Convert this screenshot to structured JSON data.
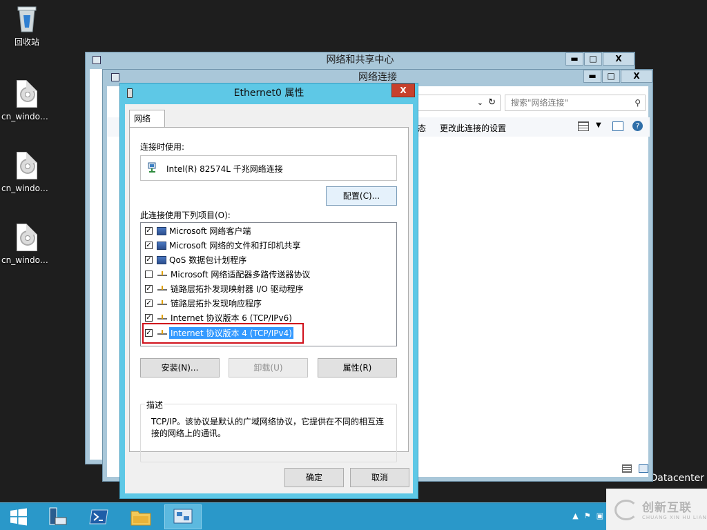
{
  "desktop": {
    "icons": [
      {
        "label": "回收站",
        "icon": "recycle-bin-icon"
      },
      {
        "label": "cn_window...",
        "icon": "disc-image-icon"
      },
      {
        "label": "cn_window...",
        "icon": "disc-image-icon"
      },
      {
        "label": "cn_window...",
        "icon": "disc-image-icon"
      }
    ],
    "side_text": "Datacenter"
  },
  "window_network_center": {
    "title": "网络和共享中心",
    "controls": {
      "minimize": "▬",
      "maximize": "□",
      "close": "X"
    }
  },
  "window_network_connections": {
    "title": "网络连接",
    "controls": {
      "minimize": "▬",
      "maximize": "□",
      "close": "X"
    },
    "search_placeholder": "搜索\"网络连接\"",
    "toolbar": {
      "partial_label": "态",
      "change_settings": "更改此连接的设置"
    }
  },
  "dialog": {
    "title": "Ethernet0 属性",
    "close": "X",
    "tab": "网络",
    "connect_using_label": "连接时使用:",
    "adapter_name": "Intel(R) 82574L 千兆网络连接",
    "configure_button": "配置(C)...",
    "items_label": "此连接使用下列项目(O):",
    "items": [
      {
        "checked": true,
        "icon": "network-client-icon",
        "label": "Microsoft 网络客户端",
        "selected": false
      },
      {
        "checked": true,
        "icon": "network-service-icon",
        "label": "Microsoft 网络的文件和打印机共享",
        "selected": false
      },
      {
        "checked": true,
        "icon": "network-service-icon",
        "label": "QoS 数据包计划程序",
        "selected": false
      },
      {
        "checked": false,
        "icon": "protocol-icon",
        "label": "Microsoft 网络适配器多路传送器协议",
        "selected": false
      },
      {
        "checked": true,
        "icon": "protocol-icon",
        "label": "链路层拓扑发现映射器 I/O 驱动程序",
        "selected": false
      },
      {
        "checked": true,
        "icon": "protocol-icon",
        "label": "链路层拓扑发现响应程序",
        "selected": false
      },
      {
        "checked": true,
        "icon": "protocol-icon",
        "label": "Internet 协议版本 6 (TCP/IPv6)",
        "selected": false
      },
      {
        "checked": true,
        "icon": "protocol-icon",
        "label": "Internet 协议版本 4 (TCP/IPv4)",
        "selected": true
      }
    ],
    "install_button": "安装(N)...",
    "uninstall_button": "卸载(U)",
    "properties_button": "属性(R)",
    "description_legend": "描述",
    "description_text": "TCP/IP。该协议是默认的广域网络协议，它提供在不同的相互连接的网络上的通讯。",
    "ok_button": "确定",
    "cancel_button": "取消"
  },
  "watermark": {
    "title": "创新互联",
    "subtitle": "CHUANG XIN HU LIAN"
  },
  "colors": {
    "accent": "#5ec8e6",
    "taskbar": "#2a98c9",
    "selection": "#3399ff",
    "highlight_box": "#d0101b"
  }
}
